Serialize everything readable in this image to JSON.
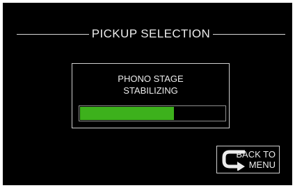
{
  "header": {
    "title": "PICKUP SELECTION"
  },
  "status": {
    "line1": "PHONO STAGE",
    "line2": "STABILIZING",
    "progress": 0.65
  },
  "back_button": {
    "line1": "BACK TO",
    "line2": "MENU",
    "icon": "return-arrow-icon"
  },
  "colors": {
    "background": "#000000",
    "text": "#ececec",
    "accent": "#3db11c",
    "border": "#d0d0d0"
  }
}
